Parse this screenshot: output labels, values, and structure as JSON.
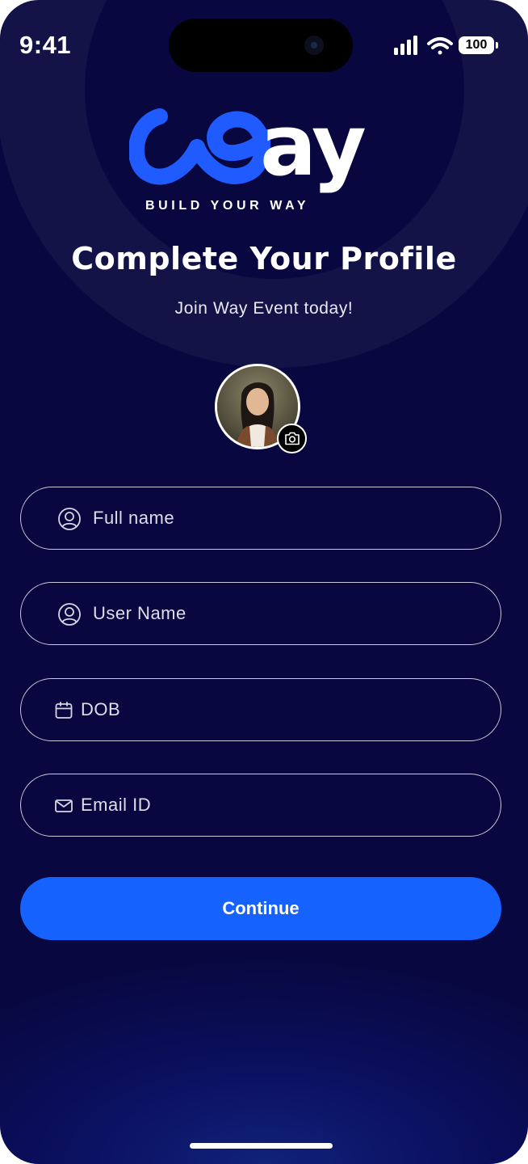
{
  "status_bar": {
    "time": "9:41",
    "battery": "100",
    "icons": [
      "cellular-signal-icon",
      "wifi-icon",
      "battery-icon"
    ]
  },
  "brand": {
    "wordmark": "ay",
    "logo_mark": "w-swirl-logo",
    "tagline": "BUILD YOUR WAY",
    "accent_color": "#1562ff"
  },
  "header": {
    "title": "Complete Your Profile",
    "subtitle": "Join Way Event today!"
  },
  "avatar": {
    "camera_icon": "camera-icon"
  },
  "form": {
    "full_name": {
      "placeholder": "Full name",
      "icon": "user-circle-icon"
    },
    "user_name": {
      "placeholder": "User Name",
      "icon": "user-circle-icon"
    },
    "dob": {
      "placeholder": "DOB",
      "icon": "calendar-icon"
    },
    "email": {
      "placeholder": "Email ID",
      "icon": "mail-icon"
    }
  },
  "actions": {
    "continue_label": "Continue"
  },
  "colors": {
    "background": "#08073f",
    "primary_button": "#1562ff",
    "field_border": "#c9c9d8"
  }
}
